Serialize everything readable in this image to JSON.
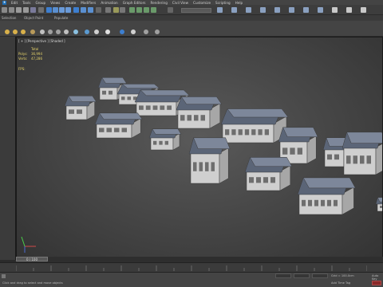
{
  "menu": [
    "Edit",
    "Tools",
    "Group",
    "Views",
    "Create",
    "Modifiers",
    "Animation",
    "Graph Editors",
    "Rendering",
    "Civil View",
    "Customize",
    "Scripting",
    "Help"
  ],
  "ribbon_tabs": [
    "Selection",
    "Object Paint",
    "Populate"
  ],
  "viewport": {
    "label": "[ + ] [Perspective ] [Shaded ]",
    "stats_header": "Total",
    "polys_label": "Polys:",
    "polys_value": "36,994",
    "verts_label": "Verts:",
    "verts_value": "47,286",
    "fps_label": "FPS:"
  },
  "timeline": {
    "frame_label": "0 / 100"
  },
  "status": {
    "message": "Click and drag to select and move objects",
    "grid": "Grid = 100.0cm",
    "add_time_tag": "Add Time Tag",
    "auto_key": "Auto Key"
  },
  "colors": {
    "accent_blue": "#1e6fb8",
    "stats_yellow": "#e6d36a",
    "house_wall": "#cfcfcf",
    "house_roof": "#5b6577"
  }
}
